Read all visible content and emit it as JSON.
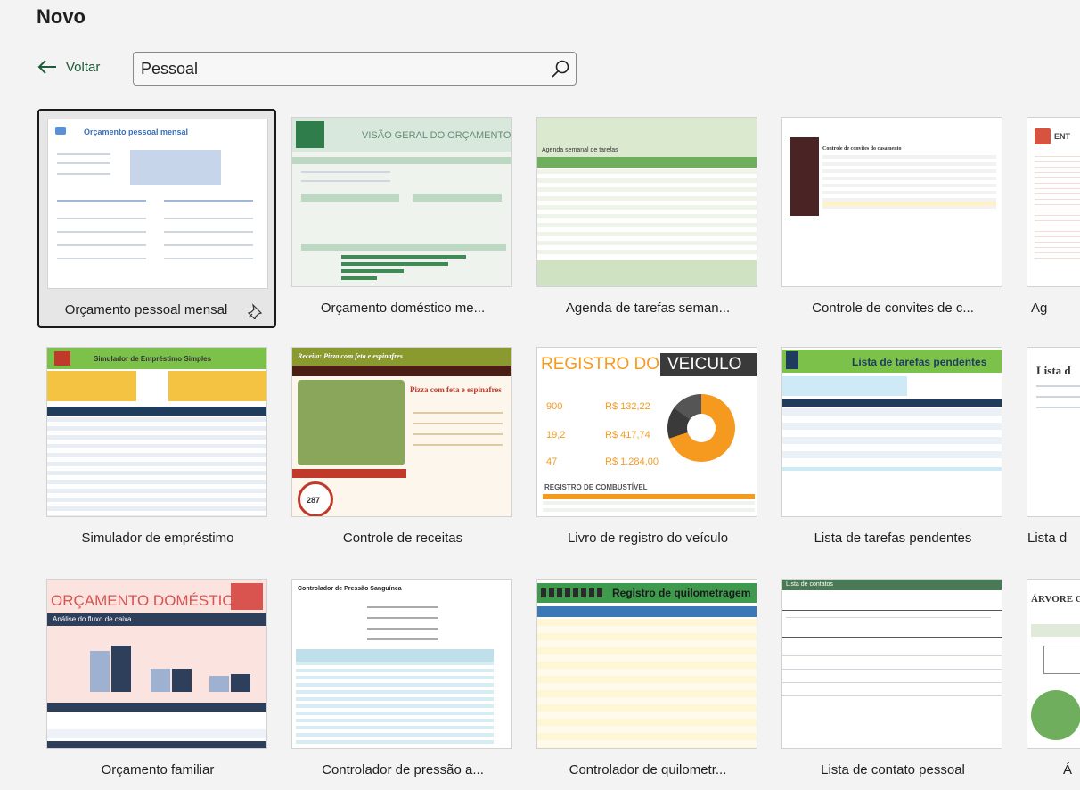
{
  "page": {
    "title": "Novo"
  },
  "nav": {
    "back_label": "Voltar"
  },
  "search": {
    "value": "Pessoal",
    "placeholder": ""
  },
  "templates": [
    {
      "label": "Orçamento pessoal mensal",
      "thumb_title": "Orçamento pessoal mensal",
      "selected": true
    },
    {
      "label": "Orçamento doméstico me...",
      "thumb_title": "VISÃO GERAL DO ORÇAMENTO"
    },
    {
      "label": "Agenda de tarefas seman...",
      "thumb_title": "Agenda semanal de tarefas"
    },
    {
      "label": "Controle de convites de c...",
      "thumb_title": "Controle de convites do casamento"
    },
    {
      "label": "Ag",
      "thumb_title": "ENT"
    },
    {
      "label": "Simulador de empréstimo",
      "thumb_title": "Simulador de Empréstimo Simples"
    },
    {
      "label": "Controle de receitas",
      "thumb_title": "Receita: Pizza com feta e espinafres",
      "thumb_subtitle": "Pizza com feta e espinafres",
      "thumb_number": "287"
    },
    {
      "label": "Livro de registro do veículo",
      "thumb_title_a": "REGISTRO DO",
      "thumb_title_b": "VEICULO",
      "thumb_v1": "R$ 132,22",
      "thumb_v2": "R$ 417,74",
      "thumb_v3": "R$ 1.284,00",
      "thumb_n1": "900",
      "thumb_n2": "19,2",
      "thumb_n3": "47",
      "thumb_footer": "REGISTRO DE COMBUSTÍVEL"
    },
    {
      "label": "Lista de tarefas pendentes",
      "thumb_title": "Lista de tarefas pendentes"
    },
    {
      "label": "Lista d",
      "thumb_title": "Lista d"
    },
    {
      "label": "Orçamento familiar",
      "thumb_title": "ORÇAMENTO DOMÉSTICO",
      "thumb_subtitle": "Análise do fluxo de caixa"
    },
    {
      "label": "Controlador de pressão a...",
      "thumb_title": "Controlador de Pressão Sanguínea"
    },
    {
      "label": "Controlador de quilometr...",
      "thumb_title": "Registro de quilometragem"
    },
    {
      "label": "Lista de contato pessoal",
      "thumb_title": "Lista de contatos"
    },
    {
      "label": "Á",
      "thumb_title": "ÁRVORE G"
    }
  ],
  "colors": {
    "accent_green": "#1e5c3a",
    "selected_border": "#1a1a1a"
  },
  "icons": {
    "back": "arrow-left-icon",
    "search": "search-icon",
    "pin": "pin-icon"
  }
}
